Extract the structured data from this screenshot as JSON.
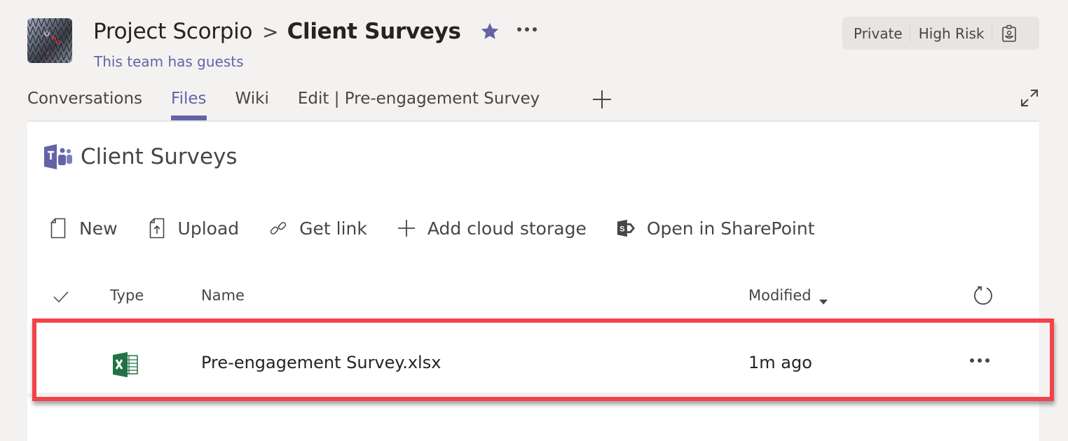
{
  "header": {
    "team_name": "Project Scorpio",
    "breadcrumb_separator": ">",
    "channel_name": "Client Surveys",
    "guests_notice": "This team has guests",
    "favorite": true,
    "badges": {
      "privacy": "Private",
      "classification": "High Risk"
    }
  },
  "tabs": [
    {
      "label": "Conversations",
      "active": false
    },
    {
      "label": "Files",
      "active": true
    },
    {
      "label": "Wiki",
      "active": false
    },
    {
      "label": "Edit | Pre-engagement Survey",
      "active": false
    }
  ],
  "panel": {
    "title": "Client Surveys",
    "toolbar": {
      "new_label": "New",
      "upload_label": "Upload",
      "get_link_label": "Get link",
      "add_cloud_storage_label": "Add cloud storage",
      "open_in_sharepoint_label": "Open in SharePoint"
    },
    "columns": {
      "type": "Type",
      "name": "Name",
      "modified": "Modified"
    },
    "files": [
      {
        "type_icon": "excel-icon",
        "name": "Pre-engagement Survey.xlsx",
        "modified": "1m ago"
      }
    ]
  },
  "colors": {
    "accent": "#6264a7",
    "highlight": "#f24349",
    "excel_green": "#217346",
    "background": "#f3f2f1"
  }
}
